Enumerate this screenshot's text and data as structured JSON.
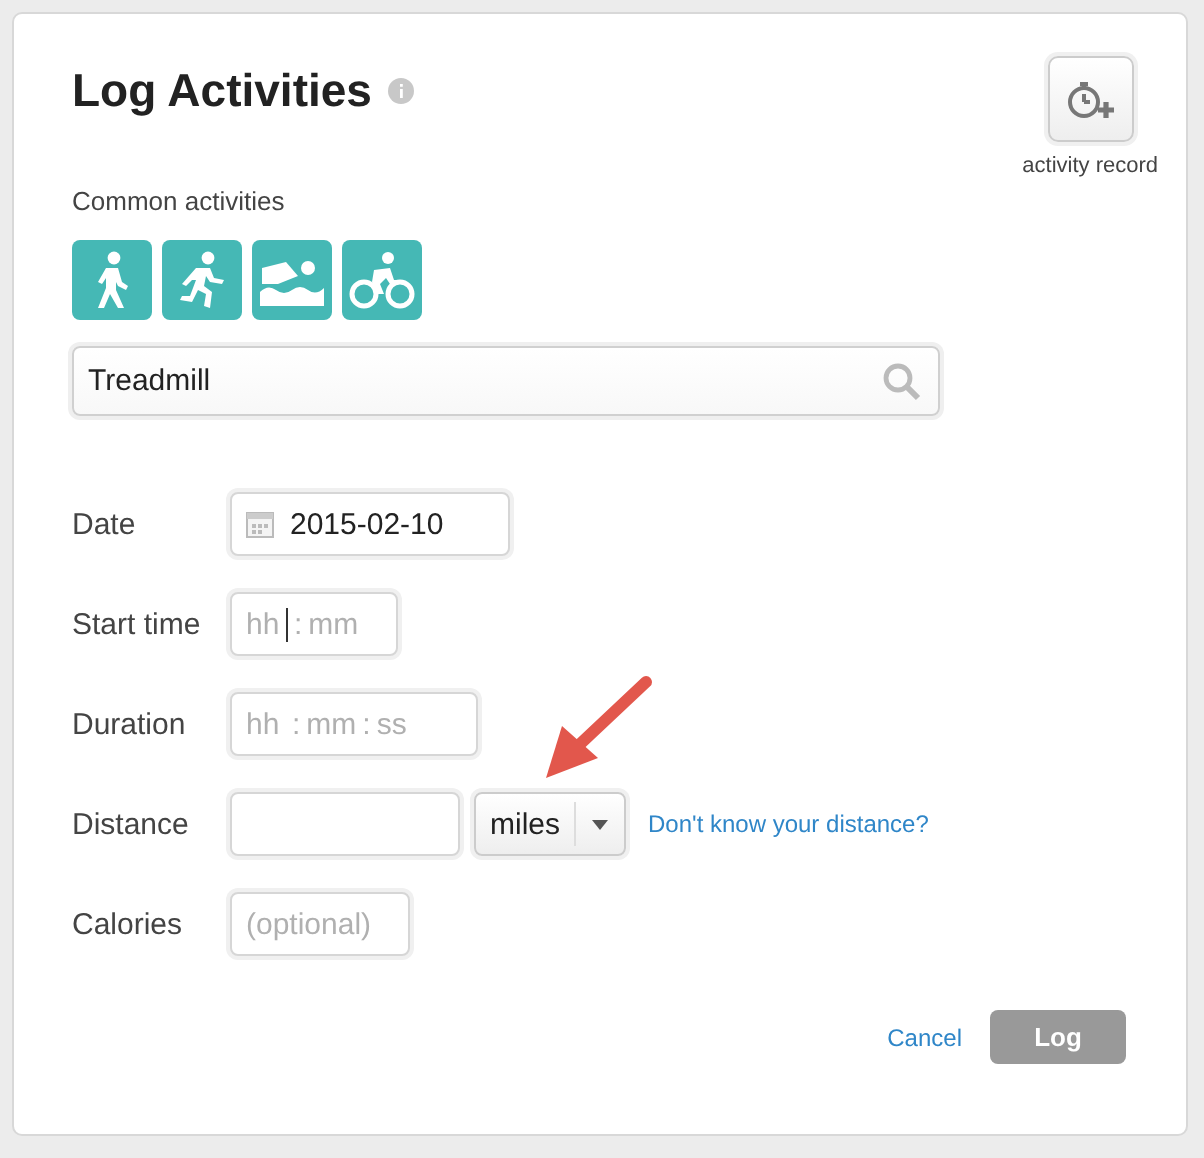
{
  "title": "Log Activities",
  "record_button": {
    "label": "activity record"
  },
  "common_activities": {
    "label": "Common activities",
    "items": [
      {
        "kind": "walk"
      },
      {
        "kind": "run"
      },
      {
        "kind": "swim"
      },
      {
        "kind": "bike"
      }
    ]
  },
  "search": {
    "value": "Treadmill"
  },
  "fields": [
    {
      "kind": "date",
      "label": "Date",
      "value": "2015-02-10"
    },
    {
      "kind": "time",
      "label": "Start time",
      "separator": ":",
      "parts": [
        {
          "placeholder": "hh"
        },
        {
          "placeholder": "mm"
        }
      ]
    },
    {
      "kind": "time",
      "label": "Duration",
      "separator": ":",
      "parts": [
        {
          "placeholder": "hh"
        },
        {
          "placeholder": "mm"
        },
        {
          "placeholder": "ss"
        }
      ]
    },
    {
      "kind": "distance",
      "label": "Distance",
      "unit": "miles",
      "link": "Don't know your distance?"
    },
    {
      "kind": "text",
      "label": "Calories",
      "placeholder": "(optional)"
    }
  ],
  "cancel": {
    "label": "Cancel"
  },
  "submit": {
    "label": "Log",
    "disabled": true
  }
}
